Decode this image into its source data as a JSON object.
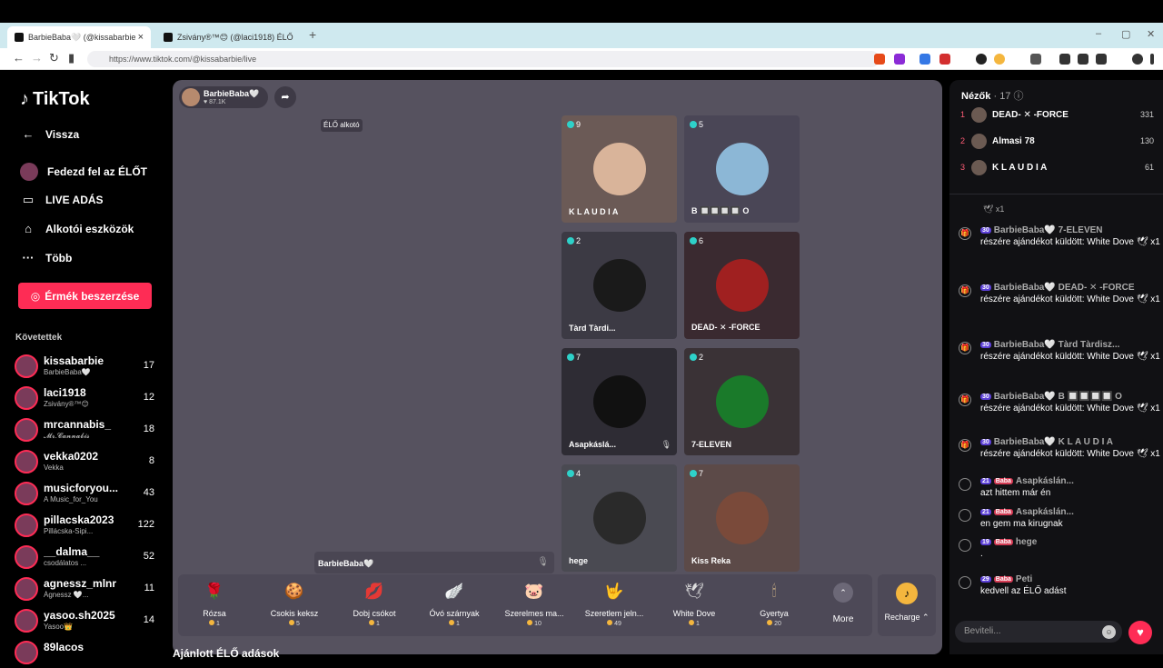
{
  "browser": {
    "tabs": [
      {
        "title": "BarbieBaba🤍 (@kissabarbie",
        "close": "×"
      },
      {
        "title": "Zsivány®™😊 (@laci1918) ÉLŐ",
        "close": "×"
      }
    ],
    "new_tab": "+",
    "window_controls": [
      "–",
      "▢",
      "✕"
    ],
    "url": "https://www.tiktok.com/@kissabarbie/live"
  },
  "sidebar": {
    "logo": "TikTok",
    "back_label": "Vissza",
    "menu": [
      {
        "label": "Fedezd fel az ÉLŐT",
        "icon": "live-explore-icon"
      },
      {
        "label": "LIVE ADÁS",
        "icon": "camera-icon"
      },
      {
        "label": "Alkotói eszközök",
        "icon": "home-icon"
      },
      {
        "label": "Több",
        "icon": "more-icon"
      }
    ],
    "coins_button": "Érmék beszerzése",
    "following_header": "Követettek",
    "following": [
      {
        "name": "kissabarbie",
        "sub": "BarbieBaba🤍",
        "count": "17"
      },
      {
        "name": "laci1918",
        "sub": "Zsivány®™😊",
        "count": "12"
      },
      {
        "name": "mrcannabis_",
        "sub": "𝓜𝓻.𝓒𝓪𝓷𝓷𝓪𝓫𝓲𝓼",
        "count": "18"
      },
      {
        "name": "vekka0202",
        "sub": "Vekka",
        "count": "8"
      },
      {
        "name": "musicforyou...",
        "sub": "A Music_for_You",
        "count": "43"
      },
      {
        "name": "pillacska2023",
        "sub": "Pillácska-Sipi...",
        "count": "122"
      },
      {
        "name": "__dalma__",
        "sub": "csodálatos ...",
        "count": "52"
      },
      {
        "name": "agnessz_mlnr",
        "sub": "Ágnessz 🤍...",
        "count": "11"
      },
      {
        "name": "yasoo.sh2025",
        "sub": "Yasoo👑",
        "count": "14"
      },
      {
        "name": "89lacos",
        "sub": "",
        "count": ""
      }
    ]
  },
  "stage": {
    "host_name": "BarbieBaba🤍",
    "host_likes": "87.1K",
    "creator_label": "ÉLŐ alkotó",
    "host_bar_name": "BarbieBaba🤍",
    "guests": [
      {
        "count": "9",
        "label": "K L A U D I A"
      },
      {
        "count": "5",
        "label": "B 🔲🔲🔲🔲 O"
      },
      {
        "count": "2",
        "label": "Tàrd Tàrdi..."
      },
      {
        "count": "6",
        "label": "DEAD- ✕ -FORCE"
      },
      {
        "count": "7",
        "label": "Asapkáslá..."
      },
      {
        "count": "2",
        "label": "7-ELEVEN"
      },
      {
        "count": "4",
        "label": "hege"
      },
      {
        "count": "7",
        "label": "Kiss Reka"
      }
    ]
  },
  "gifts": [
    {
      "name": "Rózsa",
      "price": "1",
      "icon": "🌹"
    },
    {
      "name": "Csokis keksz",
      "price": "5",
      "icon": "🍪"
    },
    {
      "name": "Dobj csókot",
      "price": "1",
      "icon": "💋"
    },
    {
      "name": "Óvó szárnyak",
      "price": "1",
      "icon": "🪽"
    },
    {
      "name": "Szerelmes ma...",
      "price": "10",
      "icon": "🐷"
    },
    {
      "name": "Szeretlem jeln...",
      "price": "49",
      "icon": "🤟"
    },
    {
      "name": "White Dove",
      "price": "1",
      "icon": "🕊"
    },
    {
      "name": "Gyertya",
      "price": "20",
      "icon": "🕯"
    }
  ],
  "more_label": "More",
  "recharge_label": "Recharge ⌃",
  "below_title": "Ajánlott ÉLŐ adások",
  "viewers": {
    "title": "Nézők",
    "count": "· 17",
    "top": [
      {
        "rank": "1",
        "name": "DEAD- ✕ -FORCE",
        "score": "331"
      },
      {
        "rank": "2",
        "name": "Almasi 78",
        "score": "130"
      },
      {
        "rank": "3",
        "name": "K L A U D I A",
        "score": "61"
      }
    ]
  },
  "chat": [
    {
      "level": "30",
      "user": "BarbieBaba🤍 7-ELEVEN",
      "text": "részére ajándékot küldött: White Dove 🕊 x1"
    },
    {
      "level": "30",
      "user": "BarbieBaba🤍 DEAD- ✕ -FORCE",
      "text": "részére ajándékot küldött: White Dove 🕊 x1"
    },
    {
      "level": "30",
      "user": "BarbieBaba🤍 Tàrd Tàrdisz...",
      "text": "részére ajándékot küldött: White Dove 🕊 x1"
    },
    {
      "level": "30",
      "user": "BarbieBaba🤍 B 🔲🔲🔲🔲 O",
      "text": "részére ajándékot küldött: White Dove 🕊 x1"
    },
    {
      "level": "30",
      "user": "BarbieBaba🤍 K L A U D I A",
      "text": "részére ajándékot küldött: White Dove 🕊 x1"
    },
    {
      "level": "21",
      "badge": "Baba",
      "user": "Asapkáslán...",
      "text": "azt hittem már én"
    },
    {
      "level": "21",
      "badge": "Baba",
      "user": "Asapkáslán...",
      "text": "en gem ma kirugnak"
    },
    {
      "level": "19",
      "badge": "Baba",
      "user": "hege",
      "text": "."
    },
    {
      "level": "29",
      "badge": "Baba",
      "user": "Peti",
      "text": "kedvell az ÉLŐ adást"
    }
  ],
  "input_placeholder": "Beviteli...",
  "colors": {
    "accent": "#fe2c55",
    "stage": "#56525f",
    "teal": "#2ed1c9"
  }
}
